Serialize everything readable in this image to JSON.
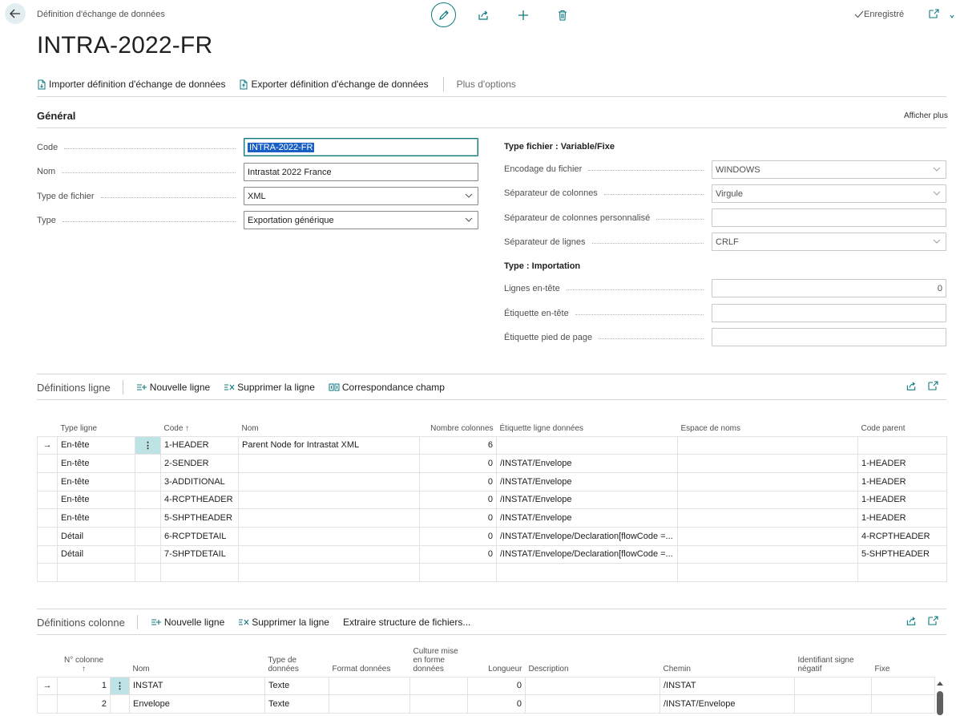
{
  "header": {
    "breadcrumb": "Définition d'échange de données",
    "title": "INTRA-2022-FR",
    "saved_status": "Enregistré"
  },
  "actions": {
    "import": "Importer définition d'échange de données",
    "export": "Exporter définition d'échange de données",
    "more": "Plus d'options"
  },
  "general": {
    "title": "Général",
    "show_more": "Afficher plus",
    "left_fields": [
      {
        "label": "Code",
        "value": "INTRA-2022-FR"
      },
      {
        "label": "Nom",
        "value": "Intrastat 2022 France"
      },
      {
        "label": "Type de fichier",
        "value": "XML"
      },
      {
        "label": "Type",
        "value": "Exportation générique"
      }
    ],
    "variable_title": "Type fichier : Variable/Fixe",
    "right_fields": [
      {
        "label": "Encodage du fichier",
        "value": "WINDOWS"
      },
      {
        "label": "Séparateur de colonnes",
        "value": "Virgule"
      },
      {
        "label": "Séparateur de colonnes personnalisé",
        "value": ""
      },
      {
        "label": "Séparateur de lignes",
        "value": "CRLF"
      }
    ],
    "import_title": "Type : Importation",
    "import_fields": [
      {
        "label": "Lignes en-tête",
        "value": "0"
      },
      {
        "label": "Étiquette en-tête",
        "value": ""
      },
      {
        "label": "Étiquette pied de page",
        "value": ""
      }
    ]
  },
  "line_defs": {
    "title": "Définitions ligne",
    "new_line": "Nouvelle ligne",
    "delete_line": "Supprimer la ligne",
    "field_mapping": "Correspondance champ",
    "columns": [
      "Type ligne",
      "Code ↑",
      "Nom",
      "Nombre colonnes",
      "Étiquette ligne données",
      "Espace de noms",
      "Code parent"
    ],
    "rows": [
      {
        "type": "En-tête",
        "code": "1-HEADER",
        "name": "Parent Node for Intrastat XML",
        "cols": "6",
        "tag": "",
        "ns": "",
        "parent": ""
      },
      {
        "type": "En-tête",
        "code": "2-SENDER",
        "name": "",
        "cols": "0",
        "tag": "/INSTAT/Envelope",
        "ns": "",
        "parent": "1-HEADER"
      },
      {
        "type": "En-tête",
        "code": "3-ADDITIONAL",
        "name": "",
        "cols": "0",
        "tag": "/INSTAT/Envelope",
        "ns": "",
        "parent": "1-HEADER"
      },
      {
        "type": "En-tête",
        "code": "4-RCPTHEADER",
        "name": "",
        "cols": "0",
        "tag": "/INSTAT/Envelope",
        "ns": "",
        "parent": "1-HEADER"
      },
      {
        "type": "En-tête",
        "code": "5-SHPTHEADER",
        "name": "",
        "cols": "0",
        "tag": "/INSTAT/Envelope",
        "ns": "",
        "parent": "1-HEADER"
      },
      {
        "type": "Détail",
        "code": "6-RCPTDETAIL",
        "name": "",
        "cols": "0",
        "tag": "/INSTAT/Envelope/Declaration[flowCode =...",
        "ns": "",
        "parent": "4-RCPTHEADER"
      },
      {
        "type": "Détail",
        "code": "7-SHPTDETAIL",
        "name": "",
        "cols": "0",
        "tag": "/INSTAT/Envelope/Declaration[flowCode =...",
        "ns": "",
        "parent": "5-SHPTHEADER"
      }
    ]
  },
  "col_defs": {
    "title": "Définitions colonne",
    "new_line": "Nouvelle ligne",
    "delete_line": "Supprimer la ligne",
    "extract": "Extraire structure de fichiers...",
    "columns": {
      "num_a": "N° colonne",
      "num_b": "↑",
      "name": "Nom",
      "dtype_a": "Type de",
      "dtype_b": "données",
      "format": "Format données",
      "culture_a": "Culture mise",
      "culture_b": "en forme",
      "culture_c": "données",
      "length": "Longueur",
      "desc": "Description",
      "path": "Chemin",
      "neg_a": "Identifiant signe",
      "neg_b": "négatif",
      "fixed": "Fixe"
    },
    "rows": [
      {
        "num": "1",
        "name": "INSTAT",
        "dtype": "Texte",
        "format": "",
        "culture": "",
        "length": "0",
        "desc": "",
        "path": "/INSTAT",
        "neg": "",
        "fixed": ""
      },
      {
        "num": "2",
        "name": "Envelope",
        "dtype": "Texte",
        "format": "",
        "culture": "",
        "length": "0",
        "desc": "",
        "path": "/INSTAT/Envelope",
        "neg": "",
        "fixed": ""
      }
    ]
  },
  "icons": [
    "back-arrow-icon",
    "pencil-icon",
    "share-icon",
    "plus-icon",
    "trash-icon",
    "check-icon",
    "open-new-window-icon",
    "collapse-icon",
    "chevron-down-icon",
    "row-arrow-icon",
    "more-vertical-icon"
  ],
  "colors": {
    "accent": "#0e7a80",
    "selection": "#1a5fc4",
    "selected_cell": "#bde3e5"
  }
}
